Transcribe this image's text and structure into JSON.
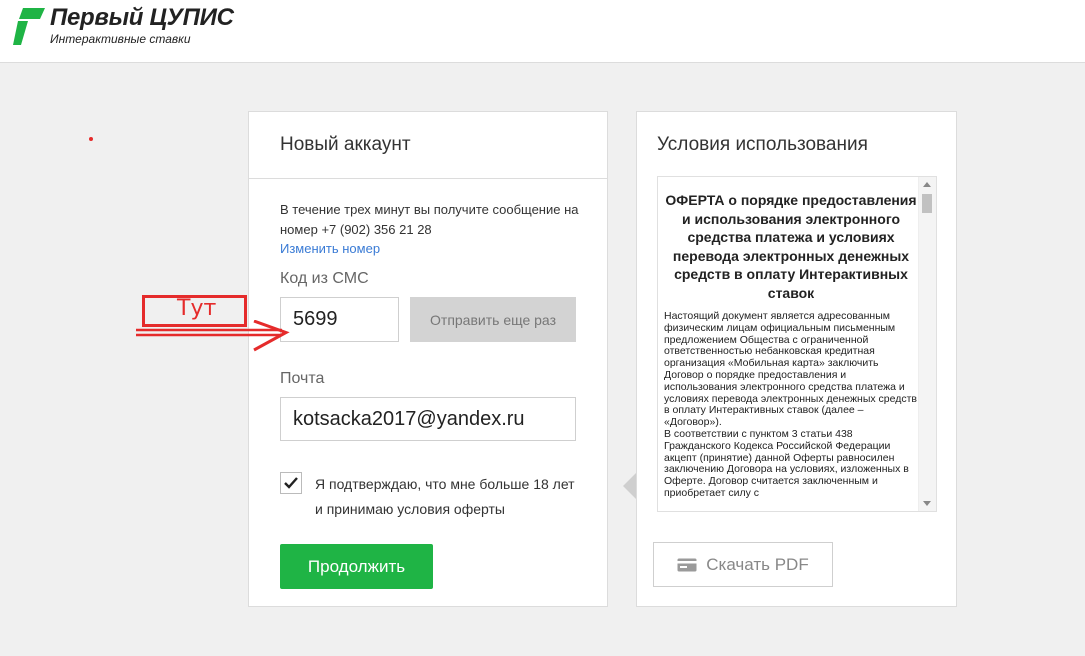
{
  "header": {
    "brand_title": "Первый ЦУПИС",
    "brand_subtitle": "Интерактивные ставки",
    "brand_color": "#1fb445"
  },
  "account_form": {
    "title": "Новый аккаунт",
    "info_text": "В течение трех минут вы получите сообщение на номер",
    "phone": "+7 (902) 356 21 28",
    "change_number_link": "Изменить номер",
    "sms_label": "Код из СМС",
    "sms_value": "5699",
    "resend_button": "Отправить еще раз",
    "email_label": "Почта",
    "email_value": "kotsacka2017@yandex.ru",
    "agree_checked": true,
    "agree_text": "Я подтверждаю, что мне больше 18 лет и принимаю условия оферты",
    "continue_button": "Продолжить",
    "continue_color": "#1fb445"
  },
  "terms": {
    "title": "Условия использования",
    "doc_heading": "ОФЕРТА о порядке предоставления и использования электронного средства платежа и условиях перевода электронных денежных средств в оплату Интерактивных ставок",
    "doc_body_1": "Настоящий документ является адресованным физическим лицам официальным письменным предложением Общества с ограниченной ответственностью небанковская кредитная организация «Мобильная карта» заключить Договор о порядке предоставления и использования электронного средства платежа и условиях перевода электронных денежных средств в оплату Интерактивных ставок (далее – «Договор»).",
    "doc_body_2": "В соответствии с пунктом 3 статьи 438 Гражданского Кодекса Российской Федерации акцепт (принятие) данной Оферты равносилен заключению Договора на условиях, изложенных в Оферте. Договор считается заключенным и приобретает силу с",
    "download_button": "Скачать PDF"
  },
  "annotation": {
    "label": "Тут",
    "color": "#e52b2b"
  }
}
